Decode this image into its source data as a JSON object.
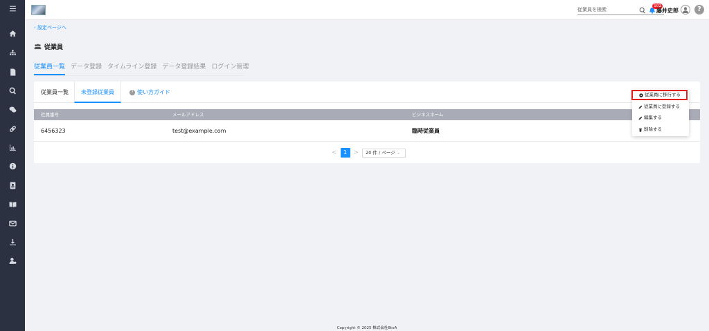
{
  "topbar": {
    "search_placeholder": "従業員を検索",
    "notification_count": "102",
    "user_name": "藤井史郎",
    "help_label": "?"
  },
  "page": {
    "back_link": "設定ページへ",
    "title": "従業員"
  },
  "tabs": [
    {
      "label": "従業員一覧",
      "active": true
    },
    {
      "label": "データ登録",
      "active": false
    },
    {
      "label": "タイムライン登録",
      "active": false
    },
    {
      "label": "データ登録結果",
      "active": false
    },
    {
      "label": "ログイン管理",
      "active": false
    }
  ],
  "subtabs": {
    "employee_list": "従業員一覧",
    "unregistered": "未登録従業員",
    "guide": "使い方ガイド"
  },
  "table": {
    "headers": [
      "社員番号",
      "メールアドレス",
      "ビジネスネーム"
    ],
    "rows": [
      {
        "id": "6456323",
        "email": "test@example.com",
        "name": "臨時従業員"
      }
    ]
  },
  "pagination": {
    "prev": "<",
    "current_page": "1",
    "next": ">",
    "page_size": "20 件 / ページ"
  },
  "dropdown": {
    "items": [
      {
        "label": "従業員に移行する",
        "icon": "dot-circle-icon"
      },
      {
        "label": "従業員に登録する",
        "icon": "pencil-icon"
      },
      {
        "label": "編集する",
        "icon": "pencil-icon"
      },
      {
        "label": "削除する",
        "icon": "trash-icon"
      }
    ]
  },
  "footer": "Copyright © 2025 株式会社BtoA"
}
